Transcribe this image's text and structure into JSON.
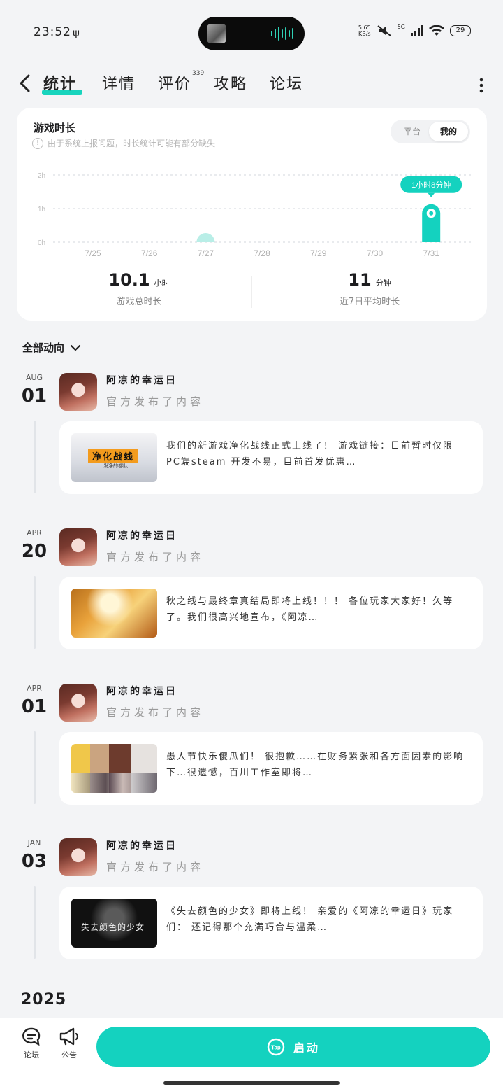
{
  "status": {
    "time": "23:52",
    "net_speed": "5.65\nKB/s",
    "net_type": "5G",
    "battery": "29"
  },
  "nav": {
    "tabs": [
      {
        "label": "统计"
      },
      {
        "label": "详情"
      },
      {
        "label": "评价"
      },
      {
        "label": "攻略"
      },
      {
        "label": "论坛"
      }
    ],
    "review_count": "339"
  },
  "stats": {
    "title": "游戏时长",
    "note": "由于系统上报问题，时长统计可能有部分缺失",
    "segment": {
      "platform": "平台",
      "mine": "我的",
      "selected": "我的"
    },
    "total_value": "10.1",
    "total_unit": "小时",
    "total_caption": "游戏总时长",
    "avg_value": "11",
    "avg_unit": "分钟",
    "avg_caption": "近7日平均时长"
  },
  "chart_data": {
    "type": "bar",
    "categories": [
      "7/25",
      "7/26",
      "7/27",
      "7/28",
      "7/29",
      "7/30",
      "7/31"
    ],
    "values": [
      0,
      0,
      0.05,
      0,
      0,
      0,
      1.13
    ],
    "yticks": [
      "0h",
      "1h",
      "2h"
    ],
    "ylim": [
      0,
      2
    ],
    "tooltip": {
      "category": "7/31",
      "text": "1小时8分钟"
    },
    "grid": true,
    "colors": {
      "bar": "#14d2bf",
      "faint_bar": "#b9eee7"
    }
  },
  "feed": {
    "filter_label": "全部动向",
    "entries": [
      {
        "month": "AUG",
        "day": "01",
        "author": "阿凉的幸运日",
        "subtitle": "官方发布了内容",
        "text": "我们的新游戏净化战线正式上线了！ 游戏链接：目前暂时仅限PC端steam 开发不易，目前首发优惠…",
        "thumb_title": "净化战线",
        "thumb_sub": "发净的都队"
      },
      {
        "month": "APR",
        "day": "20",
        "author": "阿凉的幸运日",
        "subtitle": "官方发布了内容",
        "text": "秋之线与最终章真结局即将上线！！！ 各位玩家大家好！久等了。我们很高兴地宣布，《阿凉…"
      },
      {
        "month": "APR",
        "day": "01",
        "author": "阿凉的幸运日",
        "subtitle": "官方发布了内容",
        "text": "愚人节快乐傻瓜们！ 很抱歉……在财务紧张和各方面因素的影响下…很遗憾，百川工作室即将…"
      },
      {
        "month": "JAN",
        "day": "03",
        "author": "阿凉的幸运日",
        "subtitle": "官方发布了内容",
        "text": "《失去颜色的少女》即将上线！ 亲爱的《阿凉的幸运日》玩家们： 还记得那个充满巧合与温柔…",
        "thumb_title": "失去颜色的少女"
      }
    ],
    "year_label": "2025"
  },
  "bottom": {
    "forum": "论坛",
    "notice": "公告",
    "launch": "启动",
    "tap_logo": "Tap"
  }
}
